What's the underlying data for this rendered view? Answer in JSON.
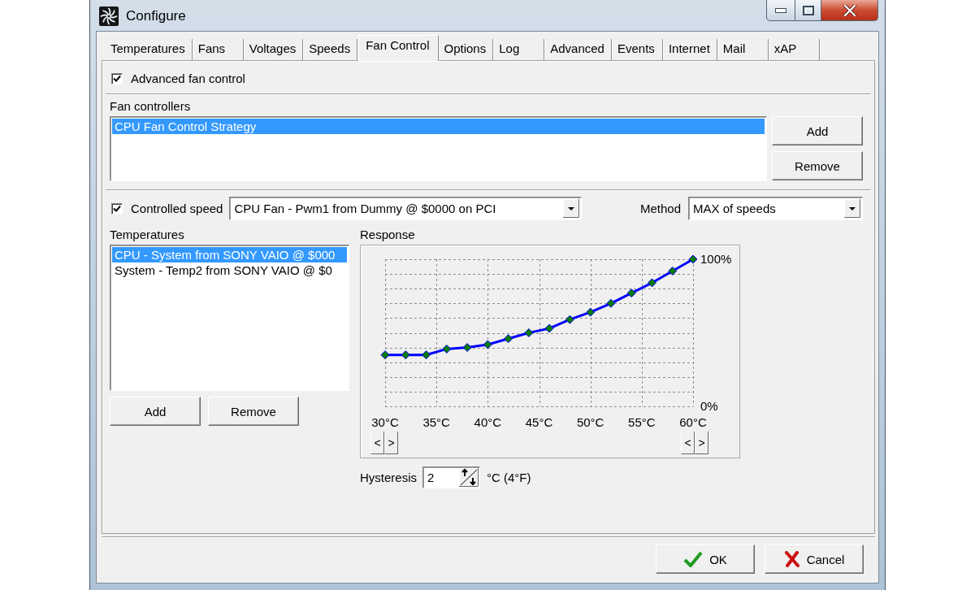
{
  "window": {
    "title": "Configure"
  },
  "tabs": [
    {
      "label": "Temperatures",
      "selected": false
    },
    {
      "label": "Fans",
      "selected": false
    },
    {
      "label": "Voltages",
      "selected": false
    },
    {
      "label": "Speeds",
      "selected": false
    },
    {
      "label": "Fan Control",
      "selected": true
    },
    {
      "label": "Options",
      "selected": false
    },
    {
      "label": "Log",
      "selected": false
    },
    {
      "label": "Advanced",
      "selected": false
    },
    {
      "label": "Events",
      "selected": false
    },
    {
      "label": "Internet",
      "selected": false
    },
    {
      "label": "Mail",
      "selected": false
    },
    {
      "label": "xAP",
      "selected": false
    }
  ],
  "advanced_fan_control": {
    "label": "Advanced fan control",
    "checked": true
  },
  "fan_controllers": {
    "label": "Fan controllers",
    "items": [
      {
        "label": "CPU Fan Control Strategy",
        "selected": true
      }
    ],
    "buttons": [
      "Add",
      "Remove"
    ]
  },
  "controlled_speed": {
    "label": "Controlled speed",
    "checked": true,
    "value": "CPU Fan - Pwm1 from Dummy @ $0000 on PCI"
  },
  "method": {
    "label": "Method",
    "value": "MAX of speeds"
  },
  "temperatures": {
    "label": "Temperatures",
    "items": [
      {
        "label": "CPU - System from SONY VAIO @ $000",
        "selected": true
      },
      {
        "label": "System - Temp2 from SONY VAIO @ $0",
        "selected": false
      }
    ],
    "buttons": [
      "Add",
      "Remove"
    ]
  },
  "response": {
    "label": "Response",
    "chart_data": {
      "type": "line",
      "grid": true,
      "x": [
        30,
        32,
        34,
        36,
        38,
        40,
        42,
        44,
        46,
        48,
        50,
        52,
        54,
        56,
        58,
        60
      ],
      "series": [
        {
          "color": "#0000ff",
          "marker": "diamond",
          "values": [
            35,
            35,
            35,
            39,
            40,
            42,
            46,
            50,
            53,
            59,
            64,
            70,
            77,
            84,
            92,
            100
          ]
        }
      ],
      "xlim": [
        30,
        60
      ],
      "ylim": [
        0,
        100
      ],
      "xticks": [
        {
          "value": 30,
          "label": "30°C"
        },
        {
          "value": 35,
          "label": "35°C"
        },
        {
          "value": 40,
          "label": "40°C"
        },
        {
          "value": 45,
          "label": "45°C"
        },
        {
          "value": 50,
          "label": "50°C"
        },
        {
          "value": 55,
          "label": "55°C"
        },
        {
          "value": 60,
          "label": "60°C"
        }
      ],
      "yticks": [
        {
          "value": 0,
          "label": "0%"
        },
        {
          "value": 100,
          "label": "100%"
        }
      ]
    },
    "scroll_pairs": [
      [
        "<",
        ">"
      ],
      [
        "<",
        ">"
      ]
    ]
  },
  "hysteresis": {
    "label": "Hysteresis",
    "value": "2",
    "unit": "°C (4°F)"
  },
  "buttons": [
    {
      "label": "OK",
      "kind": "ok"
    },
    {
      "label": "Cancel",
      "kind": "cancel"
    }
  ]
}
